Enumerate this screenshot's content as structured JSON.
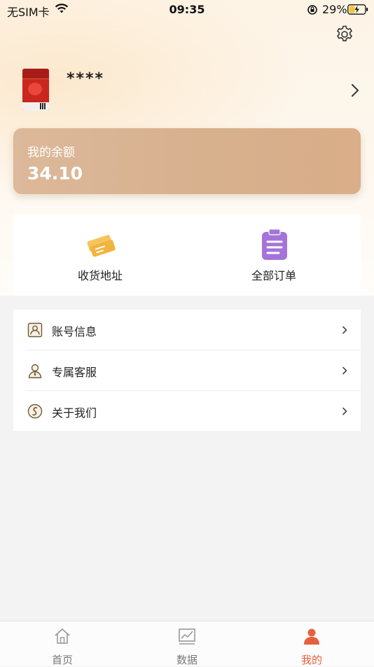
{
  "status_bar": {
    "carrier": "无SIM卡",
    "time": "09:35",
    "battery_percent": "29%",
    "icons": [
      "wifi-icon",
      "orientation-lock-icon",
      "battery-charging-icon"
    ]
  },
  "header": {
    "settings_icon": "gear-icon"
  },
  "profile": {
    "username": "****",
    "avatar_icon": "avatar-image",
    "chevron_icon": "chevron-right-icon"
  },
  "balance": {
    "label": "我的余额",
    "value": "34.10"
  },
  "quick_actions": [
    {
      "label": "收货地址",
      "icon": "ticket-icon"
    },
    {
      "label": "全部订单",
      "icon": "clipboard-icon"
    }
  ],
  "menu": [
    {
      "label": "账号信息",
      "icon": "id-card-icon"
    },
    {
      "label": "专属客服",
      "icon": "customer-service-icon"
    },
    {
      "label": "关于我们",
      "icon": "about-icon"
    }
  ],
  "tabbar": {
    "tabs": [
      {
        "label": "首页",
        "icon": "home-icon",
        "active": false
      },
      {
        "label": "数据",
        "icon": "chart-icon",
        "active": false
      },
      {
        "label": "我的",
        "icon": "user-icon",
        "active": true
      }
    ],
    "active_color": "#e5603d"
  },
  "colors": {
    "balance_card": "#d7b08e",
    "background": "#f3f3f3"
  }
}
